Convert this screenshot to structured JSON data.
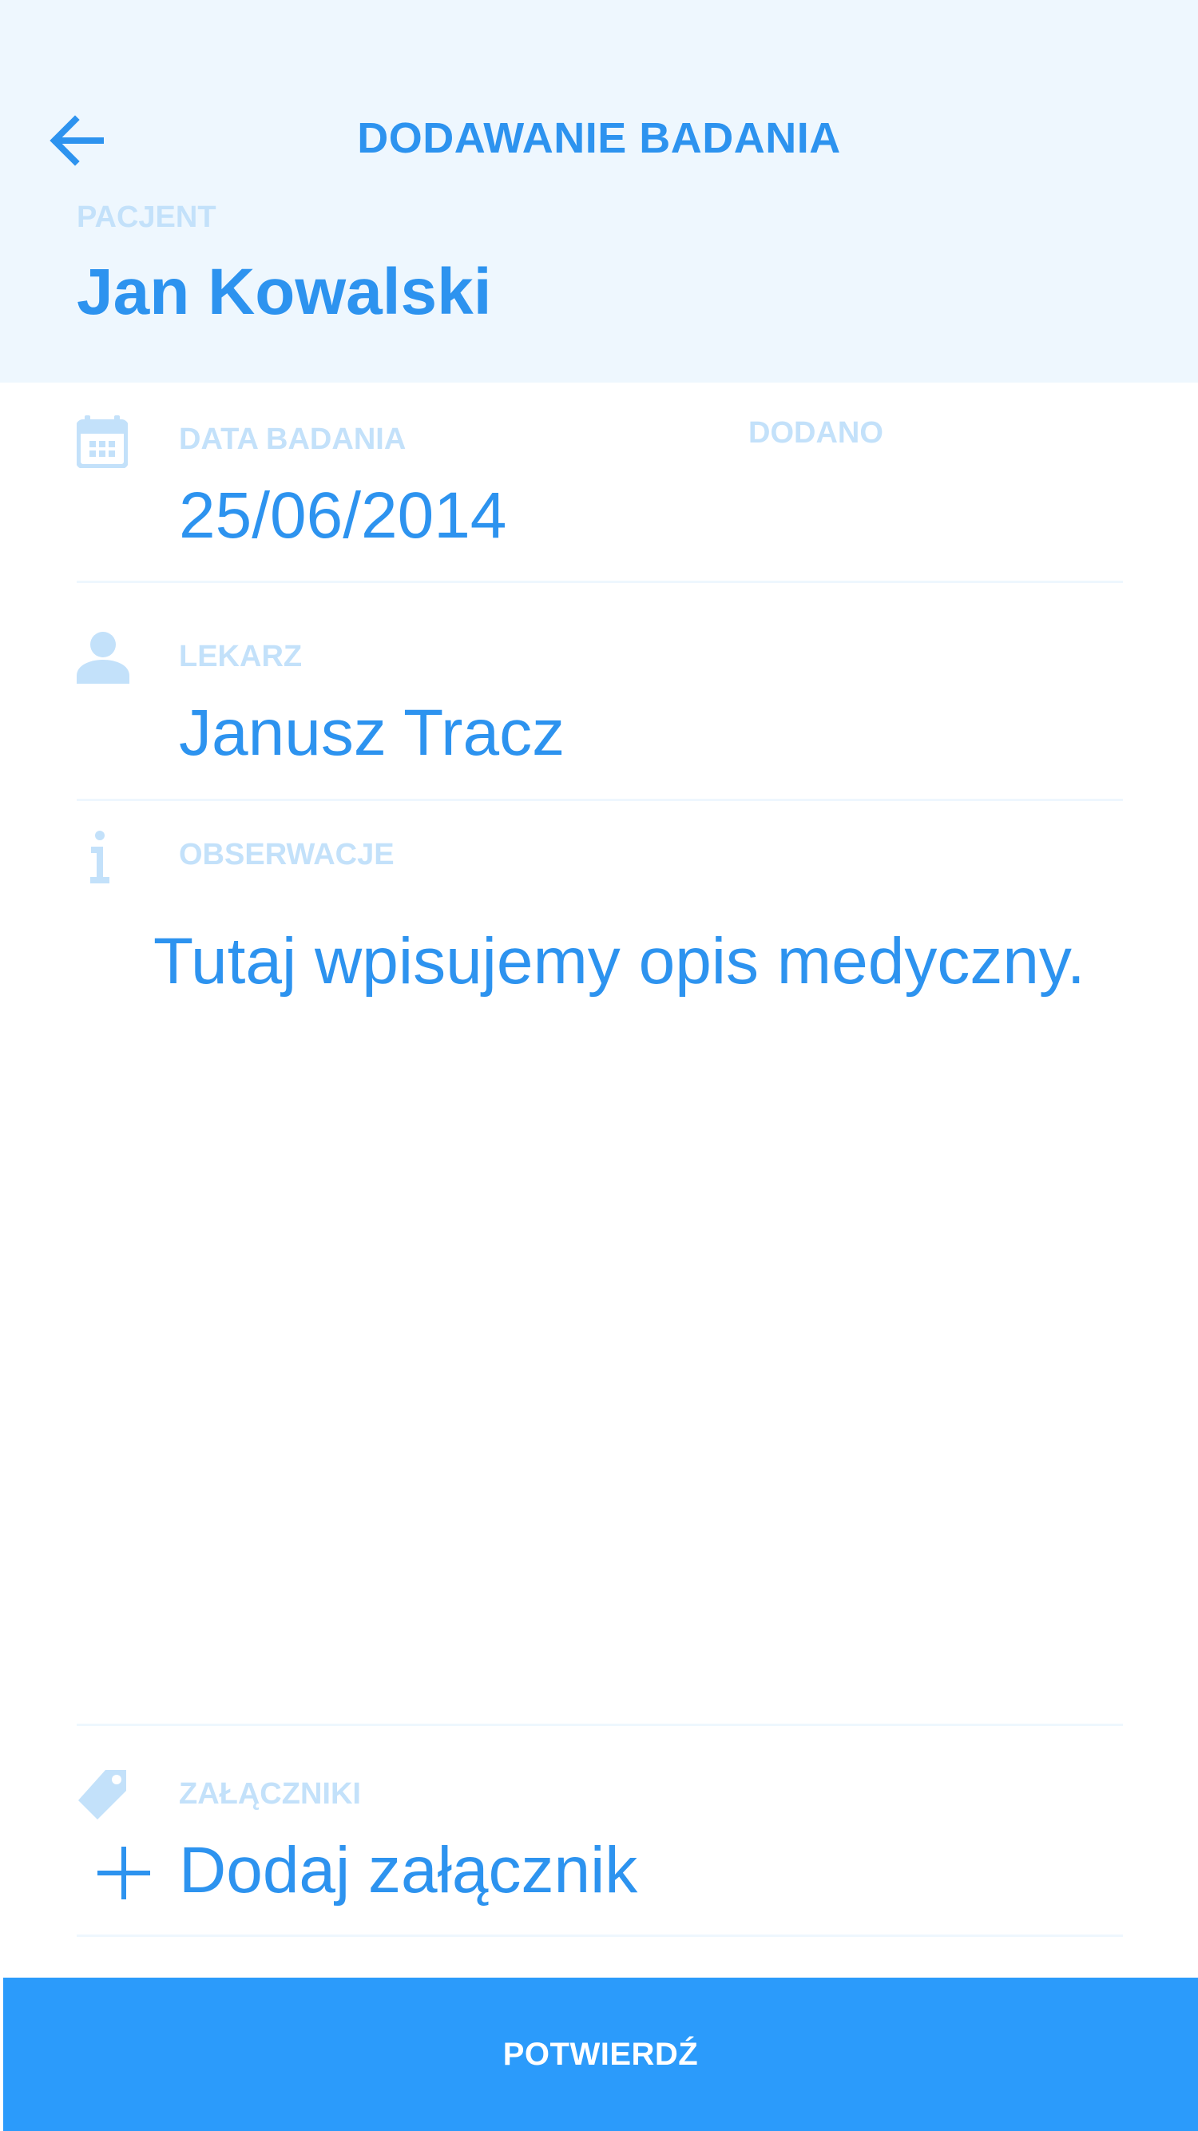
{
  "header": {
    "back_icon": "arrow-left-icon",
    "title": "DODAWANIE BADANIA",
    "patient_label": "PACJENT",
    "patient_name": "Jan Kowalski"
  },
  "fields": {
    "exam_date": {
      "icon": "calendar-icon",
      "label": "DATA BADANIA",
      "value": "25/06/2014"
    },
    "added": {
      "label": "DODANO"
    },
    "doctor": {
      "icon": "person-icon",
      "label": "LEKARZ",
      "value": "Janusz Tracz"
    },
    "observations": {
      "icon": "info-icon",
      "label": "OBSERWACJE",
      "value": "Tutaj wpisujemy opis medyczny."
    },
    "attachments": {
      "icon": "tag-icon",
      "label": "ZAŁĄCZNIKI",
      "add_icon": "plus-icon",
      "add_label": "Dodaj załącznik"
    }
  },
  "footer": {
    "confirm_label": "POTWIERDŹ"
  },
  "colors": {
    "accent": "#2d93ef",
    "label": "#c3e1fa",
    "header_bg": "#eef7fe",
    "button_bg": "#2b9bfb",
    "button_text": "#ffffff"
  }
}
